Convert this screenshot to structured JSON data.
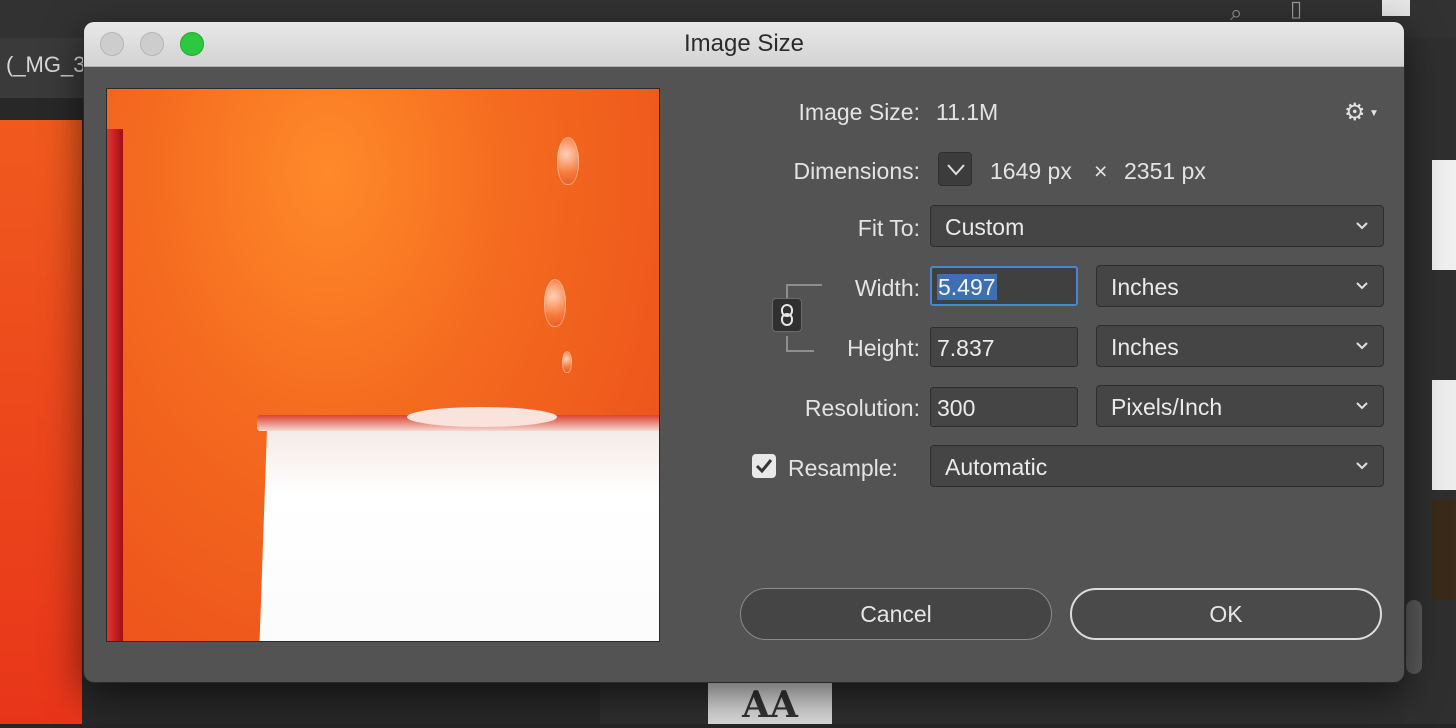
{
  "background": {
    "document_tab": "(_MG_3",
    "sample_glyphs": "AA"
  },
  "dialog": {
    "title": "Image Size",
    "image_size_label": "Image Size:",
    "image_size_value": "11.1M",
    "dimensions_label": "Dimensions:",
    "dimensions_width": "1649 px",
    "dimensions_times": "×",
    "dimensions_height": "2351 px",
    "fit_to_label": "Fit To:",
    "fit_to_value": "Custom",
    "width_label": "Width:",
    "width_value": "5.497",
    "width_unit": "Inches",
    "height_label": "Height:",
    "height_value": "7.837",
    "height_unit": "Inches",
    "resolution_label": "Resolution:",
    "resolution_value": "300",
    "resolution_unit": "Pixels/Inch",
    "resample_label": "Resample:",
    "resample_checked": true,
    "resample_value": "Automatic",
    "cancel_label": "Cancel",
    "ok_label": "OK"
  },
  "icons": {
    "settings": "gear-icon",
    "constrain": "chain-link-icon",
    "dimensions_menu": "chevron-down-icon"
  },
  "colors": {
    "dialog_bg": "#535353",
    "focus_ring": "#4a86cf",
    "traffic_green": "#2ac93f"
  }
}
